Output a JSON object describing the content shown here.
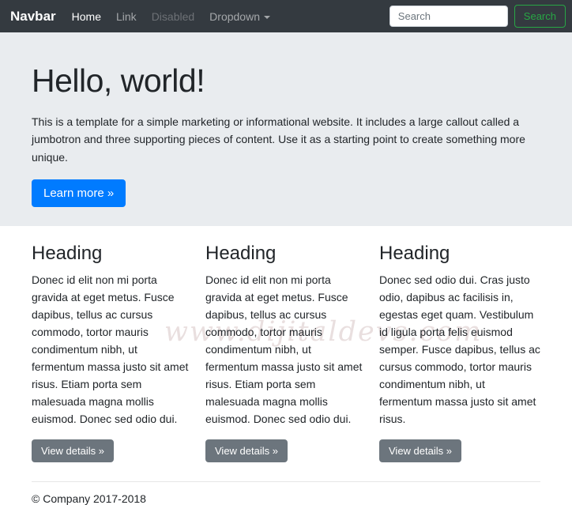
{
  "navbar": {
    "brand": "Navbar",
    "items": [
      {
        "label": "Home",
        "state": "active"
      },
      {
        "label": "Link",
        "state": "normal"
      },
      {
        "label": "Disabled",
        "state": "disabled"
      },
      {
        "label": "Dropdown",
        "state": "dropdown"
      }
    ],
    "search": {
      "placeholder": "Search",
      "button_label": "Search"
    }
  },
  "jumbotron": {
    "title": "Hello, world!",
    "description": "This is a template for a simple marketing or informational website. It includes a large callout called a jumbotron and three supporting pieces of content. Use it as a starting point to create something more unique.",
    "cta_label": "Learn more »"
  },
  "columns": [
    {
      "heading": "Heading",
      "text": "Donec id elit non mi porta gravida at eget metus. Fusce dapibus, tellus ac cursus commodo, tortor mauris condimentum nibh, ut fermentum massa justo sit amet risus. Etiam porta sem malesuada magna mollis euismod. Donec sed odio dui.",
      "button_label": "View details »"
    },
    {
      "heading": "Heading",
      "text": "Donec id elit non mi porta gravida at eget metus. Fusce dapibus, tellus ac cursus commodo, tortor mauris condimentum nibh, ut fermentum massa justo sit amet risus. Etiam porta sem malesuada magna mollis euismod. Donec sed odio dui.",
      "button_label": "View details »"
    },
    {
      "heading": "Heading",
      "text": "Donec sed odio dui. Cras justo odio, dapibus ac facilisis in, egestas eget quam. Vestibulum id ligula porta felis euismod semper. Fusce dapibus, tellus ac cursus commodo, tortor mauris condimentum nibh, ut fermentum massa justo sit amet risus.",
      "button_label": "View details »"
    }
  ],
  "footer": {
    "copyright": "© Company 2017-2018"
  },
  "watermark": {
    "text": "www.dijitaldevs.com"
  },
  "colors": {
    "navbar_bg": "#343a40",
    "jumbotron_bg": "#e9ecef",
    "primary_button": "#007bff",
    "secondary_button": "#6c757d",
    "search_button_green": "#28a745"
  }
}
